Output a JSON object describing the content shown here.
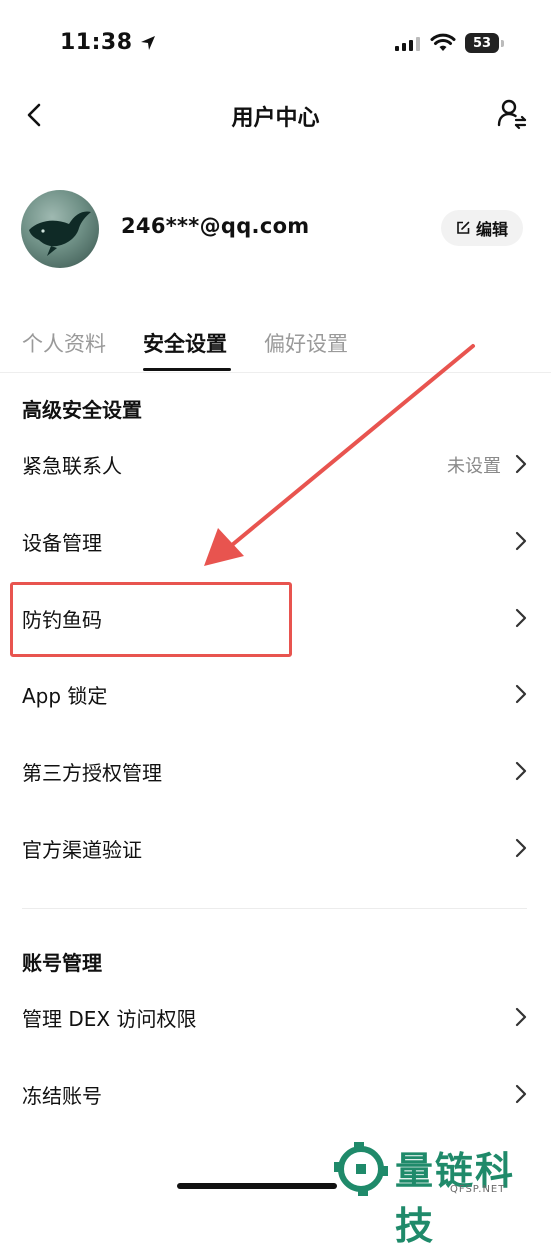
{
  "status_bar": {
    "time": "11:38",
    "battery": "53"
  },
  "nav": {
    "title": "用户中心"
  },
  "profile": {
    "email": "246***@qq.com",
    "edit_label": "编辑"
  },
  "tabs": [
    {
      "label": "个人资料",
      "active": false
    },
    {
      "label": "安全设置",
      "active": true
    },
    {
      "label": "偏好设置",
      "active": false
    }
  ],
  "security": {
    "title": "高级安全设置",
    "items": [
      {
        "label": "紧急联系人",
        "value": "未设置"
      },
      {
        "label": "设备管理"
      },
      {
        "label": "防钓鱼码"
      },
      {
        "label": "App 锁定"
      },
      {
        "label": "第三方授权管理"
      },
      {
        "label": "官方渠道验证"
      }
    ]
  },
  "account": {
    "title": "账号管理",
    "items": [
      {
        "label": "管理 DEX 访问权限"
      },
      {
        "label": "冻结账号"
      }
    ]
  },
  "watermark": {
    "text": "量链科技",
    "sub": "QFSP.NET",
    "color": "#1f8a6a"
  },
  "annotation": {
    "color": "#e8544f"
  }
}
